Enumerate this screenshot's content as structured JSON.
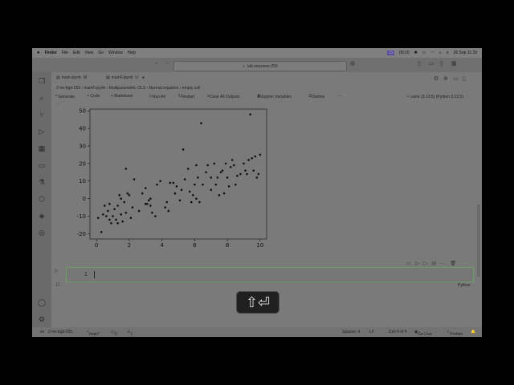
{
  "menubar": {
    "apple_icon": "apple-icon",
    "app": "Finder",
    "items": [
      "File",
      "Edit",
      "View",
      "Go",
      "Window",
      "Help"
    ],
    "status_time": "06:10",
    "datetime": "26 Sep 11:29"
  },
  "titlebar": {
    "command_center": "lab-sessions-255"
  },
  "tabs": [
    {
      "label": "main.ipynb",
      "suffix": "M"
    },
    {
      "label": "mainF.ipynb",
      "suffix": "U"
    }
  ],
  "breadcrumb": [
    "2-ne-bgd-255",
    "mainF.ipynb",
    "Multiparametric OLS",
    "Normal equation",
    "empty cell"
  ],
  "toolbar": {
    "generate": "Generate",
    "code": "+ Code",
    "markdown": "+ Markdown",
    "run_all": "Run All",
    "restart": "Restart",
    "clear_outputs": "Clear All Outputs",
    "variables": "Jupyter Variables",
    "outline": "Outline",
    "more": "···",
    "kernel": ".venv (3.13.5) (Python 3.13.5)"
  },
  "cell": {
    "line_number": "1",
    "language": "Python",
    "output_ellipsis": "..."
  },
  "statusbar": {
    "branch": "2-ne-bgd-255",
    "git": "main*",
    "errors": "0",
    "warnings": "1",
    "spaces": "Spaces: 4",
    "lf": "LF",
    "cell_pos": "Cell 4 of 4",
    "golive": "Go Live",
    "prettier": "Prettier"
  },
  "keyboard_overlay": "⇧⏎",
  "chart_data": {
    "type": "scatter",
    "title": "",
    "xlabel": "",
    "ylabel": "",
    "xlim": [
      -0.4,
      10.4
    ],
    "ylim": [
      -23,
      51
    ],
    "xticks": [
      0,
      2,
      4,
      6,
      8,
      10
    ],
    "yticks": [
      -20,
      -10,
      0,
      10,
      20,
      30,
      40,
      50
    ],
    "grid": false,
    "points": [
      [
        0.1,
        -11
      ],
      [
        0.3,
        -19
      ],
      [
        0.4,
        -9
      ],
      [
        0.5,
        -4
      ],
      [
        0.6,
        -10
      ],
      [
        0.7,
        -7
      ],
      [
        0.8,
        -12
      ],
      [
        0.8,
        -3
      ],
      [
        0.9,
        -14
      ],
      [
        1.0,
        -10
      ],
      [
        1.1,
        -6
      ],
      [
        1.2,
        -12
      ],
      [
        1.3,
        -4
      ],
      [
        1.3,
        -14
      ],
      [
        1.4,
        2
      ],
      [
        1.5,
        0
      ],
      [
        1.5,
        -9
      ],
      [
        1.6,
        -13
      ],
      [
        1.7,
        -2
      ],
      [
        1.8,
        -8
      ],
      [
        1.8,
        17
      ],
      [
        1.9,
        3
      ],
      [
        2.0,
        2
      ],
      [
        2.1,
        -11
      ],
      [
        2.2,
        -5
      ],
      [
        2.3,
        11
      ],
      [
        2.6,
        -7
      ],
      [
        2.8,
        3
      ],
      [
        3.0,
        -3
      ],
      [
        3.0,
        6
      ],
      [
        3.1,
        -3
      ],
      [
        3.2,
        -1
      ],
      [
        3.3,
        -4
      ],
      [
        3.3,
        0
      ],
      [
        3.4,
        -8
      ],
      [
        3.6,
        -10
      ],
      [
        3.7,
        8
      ],
      [
        3.9,
        10
      ],
      [
        4.2,
        -5
      ],
      [
        4.3,
        -2
      ],
      [
        4.4,
        -7
      ],
      [
        4.5,
        9
      ],
      [
        4.7,
        9
      ],
      [
        4.8,
        3
      ],
      [
        4.9,
        7
      ],
      [
        5.1,
        -1
      ],
      [
        5.2,
        5
      ],
      [
        5.3,
        28
      ],
      [
        5.4,
        11
      ],
      [
        5.6,
        17
      ],
      [
        5.7,
        4
      ],
      [
        5.8,
        -2
      ],
      [
        5.9,
        2
      ],
      [
        6.0,
        8
      ],
      [
        6.1,
        19
      ],
      [
        6.1,
        0
      ],
      [
        6.2,
        12
      ],
      [
        6.3,
        -2
      ],
      [
        6.4,
        43
      ],
      [
        6.5,
        8
      ],
      [
        6.7,
        15
      ],
      [
        6.8,
        19
      ],
      [
        7.0,
        12
      ],
      [
        7.0,
        5
      ],
      [
        7.2,
        20
      ],
      [
        7.3,
        8
      ],
      [
        7.4,
        12
      ],
      [
        7.5,
        2
      ],
      [
        7.6,
        15
      ],
      [
        7.7,
        16
      ],
      [
        7.8,
        3
      ],
      [
        7.9,
        20
      ],
      [
        8.0,
        12
      ],
      [
        8.1,
        7
      ],
      [
        8.2,
        18
      ],
      [
        8.3,
        22
      ],
      [
        8.4,
        19
      ],
      [
        8.5,
        8
      ],
      [
        8.6,
        13
      ],
      [
        8.8,
        14
      ],
      [
        9.0,
        20
      ],
      [
        9.1,
        16
      ],
      [
        9.2,
        14
      ],
      [
        9.3,
        22
      ],
      [
        9.4,
        48
      ],
      [
        9.5,
        23
      ],
      [
        9.6,
        16
      ],
      [
        9.7,
        24
      ],
      [
        9.8,
        12
      ],
      [
        9.9,
        14
      ],
      [
        10.0,
        25
      ]
    ]
  }
}
